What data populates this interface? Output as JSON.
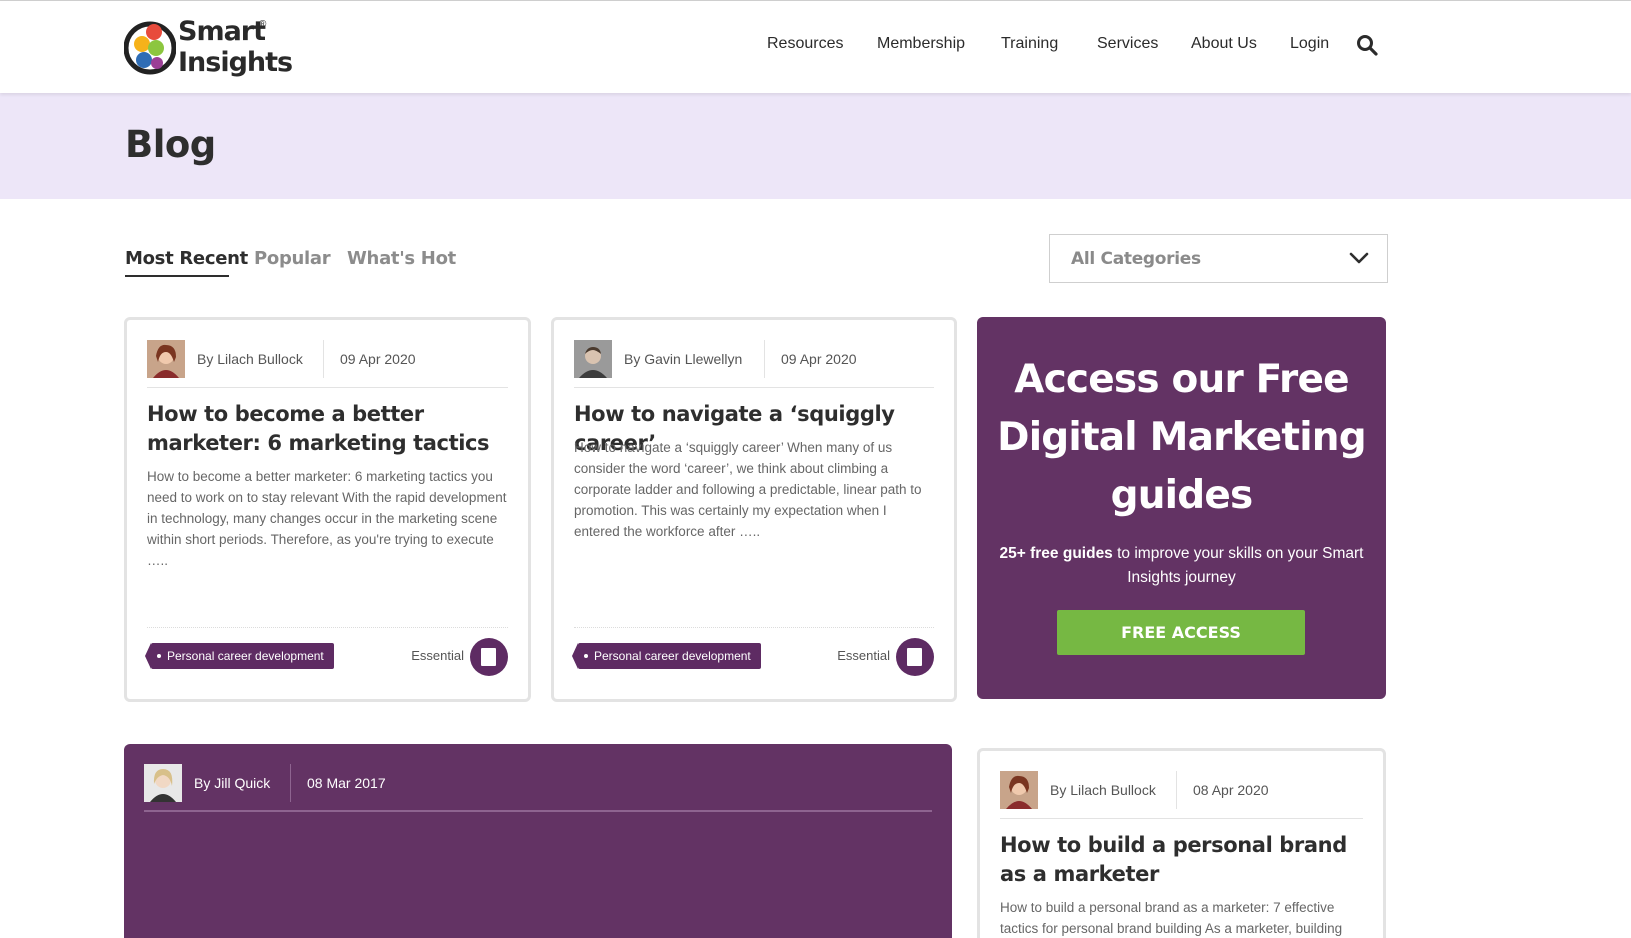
{
  "brand": {
    "line1": "Smart",
    "line2": "Insights",
    "reg": "®"
  },
  "nav": {
    "items": [
      "Resources",
      "Membership",
      "Training",
      "Services",
      "About Us",
      "Login"
    ],
    "search_icon": "search-icon"
  },
  "hero": {
    "title": "Blog"
  },
  "tabs": {
    "most_recent": "Most Recent",
    "popular": "Popular",
    "whats_hot": "What's Hot",
    "active": "Most Recent"
  },
  "category_filter": {
    "selected": "All Categories"
  },
  "posts": [
    {
      "author": "By Lilach Bullock",
      "date": "09 Apr 2020",
      "title": "How to become a better marketer: 6 marketing tactics",
      "excerpt": "How to become a better marketer: 6 marketing tactics you need to work on to stay relevant   With the rapid development in technology, many changes occur in the marketing scene within short periods. Therefore, as you're trying to execute …..",
      "tag": "Personal career development",
      "level": "Essential"
    },
    {
      "author": "By Gavin Llewellyn",
      "date": "09 Apr 2020",
      "title": "How to navigate a ‘squiggly career’",
      "excerpt": "How to navigate a ‘squiggly career’ When many of us consider the word ‘career’, we think about climbing a corporate ladder and following a predictable, linear path to promotion. This was certainly my expectation when I entered the workforce after …..",
      "tag": "Personal career development",
      "level": "Essential"
    },
    {
      "author": "By Lilach Bullock",
      "date": "08 Apr 2020",
      "title": "How to build a personal brand as a marketer",
      "excerpt": "How to build a personal brand as a marketer: 7 effective tactics for personal brand building As a marketer, building"
    }
  ],
  "featured": {
    "author": "By Jill Quick",
    "date": "08 Mar 2017"
  },
  "promo": {
    "title": "Access our Free Digital Marketing guides",
    "sub_bold": "25+ free guides",
    "sub_rest": " to improve your skills on your Smart Insights journey",
    "button": "FREE ACCESS"
  },
  "colors": {
    "brand_purple": "#633364",
    "tag_purple": "#5e2b63",
    "cta_green": "#76b843",
    "hero_bg": "#ede6f8"
  }
}
